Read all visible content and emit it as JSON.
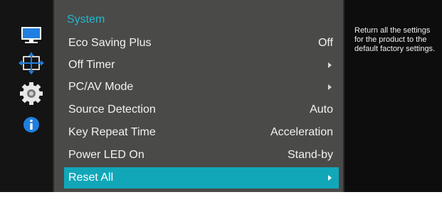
{
  "sidebar": {
    "icons": [
      {
        "name": "monitor-picture-icon"
      },
      {
        "name": "display-position-icon"
      },
      {
        "name": "gear-icon"
      },
      {
        "name": "info-icon"
      }
    ]
  },
  "menu": {
    "title": "System",
    "items": [
      {
        "label": "Eco Saving Plus",
        "value": "Off",
        "arrow": false
      },
      {
        "label": "Off Timer",
        "value": "",
        "arrow": true
      },
      {
        "label": "PC/AV Mode",
        "value": "",
        "arrow": true
      },
      {
        "label": "Source Detection",
        "value": "Auto",
        "arrow": false
      },
      {
        "label": "Key Repeat Time",
        "value": "Acceleration",
        "arrow": false
      },
      {
        "label": "Power LED On",
        "value": "Stand-by",
        "arrow": false
      },
      {
        "label": "Reset All",
        "value": "",
        "arrow": true,
        "selected": true
      }
    ]
  },
  "description": "Return all the settings for the product to the default factory settings.",
  "colors": {
    "accent": "#11a7b9",
    "title": "#25b6d1",
    "panel": "#4a4a48",
    "background": "#0d0d0d"
  }
}
